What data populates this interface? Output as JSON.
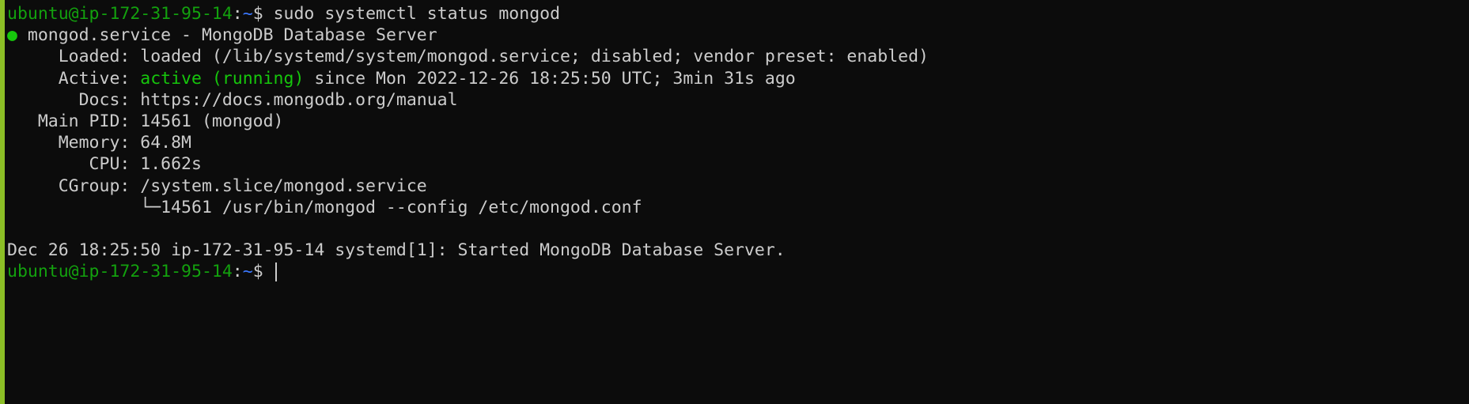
{
  "prompt": {
    "user_host": "ubuntu@ip-172-31-95-14",
    "colon": ":",
    "path": "~",
    "symbol": "$"
  },
  "command": "sudo systemctl status mongod",
  "status_dot": "●",
  "service_header": " mongod.service - MongoDB Database Server",
  "lines": {
    "loaded": "     Loaded: loaded (/lib/systemd/system/mongod.service; disabled; vendor preset: enabled)",
    "active_label": "     Active: ",
    "active_state": "active (running)",
    "active_rest": " since Mon 2022-12-26 18:25:50 UTC; 3min 31s ago",
    "docs": "       Docs: https://docs.mongodb.org/manual",
    "main_pid": "   Main PID: 14561 (mongod)",
    "memory": "     Memory: 64.8M",
    "cpu": "        CPU: 1.662s",
    "cgroup": "     CGroup: /system.slice/mongod.service",
    "cgroup_child": "             └─14561 /usr/bin/mongod --config /etc/mongod.conf"
  },
  "log_line": "Dec 26 18:25:50 ip-172-31-95-14 systemd[1]: Started MongoDB Database Server.",
  "colors": {
    "background": "#0c0c0c",
    "text": "#cccccc",
    "green": "#16c60c",
    "blue": "#3b78ff",
    "accent": "#8cbf26"
  }
}
